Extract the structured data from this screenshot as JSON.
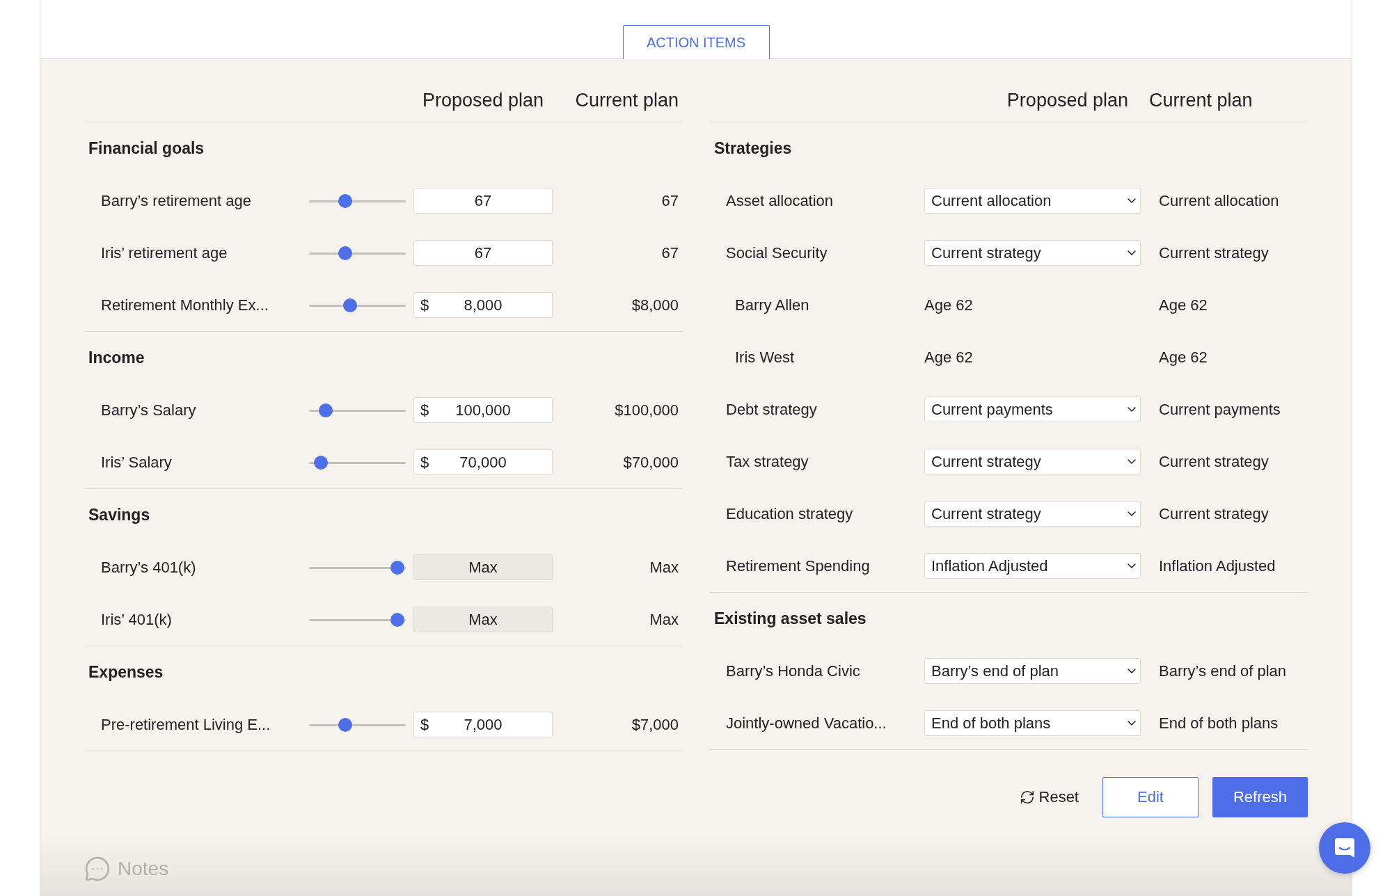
{
  "action_items_button": "ACTION ITEMS",
  "left_panel": {
    "columns": [
      "Proposed plan",
      "Current plan"
    ],
    "sections": [
      {
        "title": "Financial goals",
        "rows": [
          {
            "label": "Barry’s retirement age",
            "level": 0.35,
            "field": {
              "value": "67",
              "disabled": false
            },
            "current": "67"
          },
          {
            "label": "Iris’ retirement age",
            "level": 0.35,
            "field": {
              "value": "67",
              "disabled": false
            },
            "current": "67"
          },
          {
            "label": "Retirement Monthly Ex...",
            "level": 0.41,
            "field": {
              "prefix": "$",
              "value": "8,000",
              "disabled": false
            },
            "current": "$8,000"
          }
        ]
      },
      {
        "title": "Income",
        "rows": [
          {
            "label": "Barry’s Salary",
            "level": 0.12,
            "field": {
              "prefix": "$",
              "value": "100,000",
              "disabled": false
            },
            "current": "$100,000"
          },
          {
            "label": "Iris’ Salary",
            "level": 0.06,
            "field": {
              "prefix": "$",
              "value": "70,000",
              "disabled": false
            },
            "current": "$70,000"
          }
        ]
      },
      {
        "title": "Savings",
        "rows": [
          {
            "label": "Barry’s 401(k)",
            "level": 0.98,
            "field": {
              "value": "Max",
              "disabled": true
            },
            "current": "Max"
          },
          {
            "label": "Iris’ 401(k)",
            "level": 0.98,
            "field": {
              "value": "Max",
              "disabled": true
            },
            "current": "Max"
          }
        ]
      },
      {
        "title": "Expenses",
        "rows": [
          {
            "label": "Pre-retirement Living E...",
            "level": 0.35,
            "field": {
              "prefix": "$",
              "value": "7,000",
              "disabled": false
            },
            "current": "$7,000"
          }
        ]
      }
    ]
  },
  "right_panel": {
    "columns": [
      "Proposed plan",
      "Current plan"
    ],
    "sections": [
      {
        "title": "Strategies",
        "rows": [
          {
            "kind": "select",
            "label": "Asset allocation",
            "proposed": "Current allocation",
            "current": "Current allocation"
          },
          {
            "kind": "select",
            "label": "Social Security",
            "proposed": "Current strategy",
            "current": "Current strategy",
            "children": [
              {
                "kind": "text",
                "label": "Barry Allen",
                "proposed": "Age 62",
                "current": "Age 62"
              },
              {
                "kind": "text",
                "label": "Iris West",
                "proposed": "Age 62",
                "current": "Age 62"
              }
            ]
          },
          {
            "kind": "select",
            "label": "Debt strategy",
            "proposed": "Current payments",
            "current": "Current payments"
          },
          {
            "kind": "select",
            "label": "Tax strategy",
            "proposed": "Current strategy",
            "current": "Current strategy"
          },
          {
            "kind": "select",
            "label": "Education strategy",
            "proposed": "Current strategy",
            "current": "Current strategy"
          },
          {
            "kind": "select",
            "label": "Retirement Spending",
            "proposed": "Inflation Adjusted",
            "current": "Inflation Adjusted"
          }
        ]
      },
      {
        "title": "Existing asset sales",
        "rows": [
          {
            "kind": "select",
            "label": "Barry’s Honda Civic",
            "proposed": "Barry’s end of plan",
            "current": "Barry’s end of plan"
          },
          {
            "kind": "select",
            "label": "Jointly-owned Vacatio...",
            "proposed": "End of both plans",
            "current": "End of both plans"
          }
        ]
      }
    ]
  },
  "actions": {
    "reset": "Reset",
    "edit": "Edit",
    "refresh": "Refresh"
  },
  "notes": "Notes"
}
